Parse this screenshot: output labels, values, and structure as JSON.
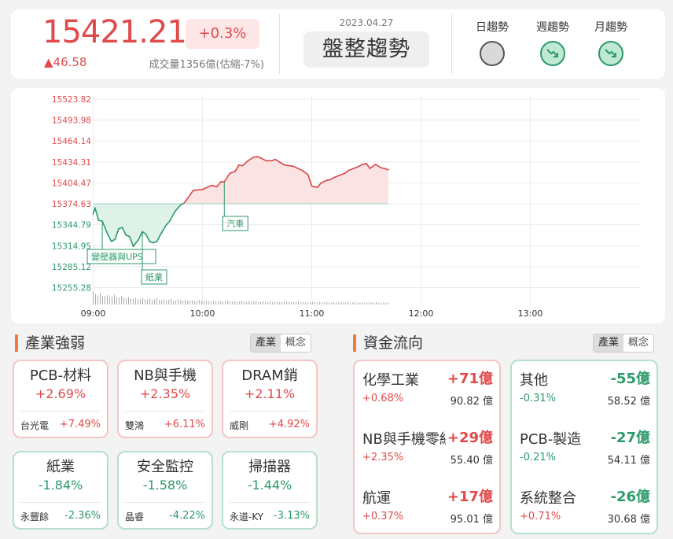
{
  "header": {
    "index_value": "15421.21",
    "index_pct": "+0.3%",
    "index_change": "▲46.58",
    "volume": "成交量1356億(估縮-7%)",
    "date": "2023.04.27",
    "trend_text": "盤整趨勢",
    "trends": [
      {
        "label": "日趨勢",
        "state": "neutral"
      },
      {
        "label": "週趨勢",
        "state": "down"
      },
      {
        "label": "月趨勢",
        "state": "down"
      }
    ]
  },
  "chart_data": {
    "type": "line",
    "y_ticks": [
      "15523.82",
      "15493.98",
      "15464.14",
      "15434.31",
      "15404.47",
      "15374.63",
      "15344.79",
      "15314.95",
      "15285.12",
      "15255.28"
    ],
    "x_ticks": [
      "09:00",
      "10:00",
      "11:00",
      "12:00",
      "13:00"
    ],
    "ylim": [
      15255.28,
      15523.82
    ],
    "reference": 15374.63,
    "series": [
      {
        "x": [
          "09:00",
          "09:01",
          "09:03",
          "09:05",
          "09:08",
          "09:10",
          "09:12",
          "09:14",
          "09:16",
          "09:18",
          "09:20",
          "09:22",
          "09:25",
          "09:27",
          "09:29",
          "09:31",
          "09:33",
          "09:35",
          "09:37",
          "09:40",
          "09:42",
          "09:45",
          "09:48",
          "09:50",
          "09:55",
          "10:00",
          "10:05",
          "10:08",
          "10:10",
          "10:12",
          "10:15",
          "10:18",
          "10:20",
          "10:22",
          "10:25",
          "10:28",
          "10:30",
          "10:32",
          "10:35",
          "10:38",
          "10:40",
          "10:45",
          "10:50",
          "10:55",
          "10:58",
          "11:00",
          "11:03",
          "11:05",
          "11:08",
          "11:10",
          "11:13",
          "11:15",
          "11:18",
          "11:20",
          "11:23",
          "11:25",
          "11:28",
          "11:30",
          "11:32",
          "11:35",
          "11:38",
          "11:40",
          "11:42"
        ],
        "values": [
          15360,
          15369,
          15351,
          15350,
          15331,
          15321,
          15324,
          15339,
          15341,
          15330,
          15328,
          15314,
          15324,
          15335,
          15331,
          15321,
          15319,
          15321,
          15331,
          15344,
          15350,
          15364,
          15373,
          15376,
          15394,
          15395,
          15401,
          15399,
          15406,
          15406,
          15418,
          15421,
          15430,
          15429,
          15436,
          15441,
          15442,
          15440,
          15436,
          15436,
          15438,
          15430,
          15428,
          15422,
          15416,
          15400,
          15398,
          15404,
          15408,
          15409,
          15413,
          15415,
          15418,
          15422,
          15425,
          15427,
          15431,
          15432,
          15425,
          15431,
          15426,
          15425,
          15423
        ]
      }
    ],
    "volume": [
      0.55,
      0.5,
      0.45,
      0.4,
      0.42,
      0.38,
      0.36,
      0.32,
      0.3,
      0.28,
      0.28,
      0.26,
      0.25,
      0.28,
      0.24,
      0.22,
      0.24,
      0.2,
      0.22,
      0.2,
      0.21,
      0.19,
      0.2,
      0.18,
      0.17,
      0.16,
      0.18,
      0.15,
      0.17,
      0.16,
      0.15,
      0.16,
      0.14,
      0.15,
      0.16,
      0.14,
      0.13,
      0.15,
      0.14,
      0.12,
      0.13,
      0.14,
      0.12,
      0.13,
      0.12,
      0.11,
      0.12,
      0.12,
      0.11,
      0.12,
      0.11,
      0.1,
      0.11,
      0.12,
      0.1,
      0.11,
      0.1,
      0.1,
      0.11,
      0.1,
      0.1,
      0.09,
      0.1
    ],
    "annotations": [
      {
        "label": "變壓器與UPS",
        "time": "09:05"
      },
      {
        "label": "紙業",
        "time": "09:27"
      },
      {
        "label": "汽車",
        "time": "10:12"
      }
    ]
  },
  "industry": {
    "title": "產業強弱",
    "tab_active": "產業",
    "tab_other": "概念",
    "cards": [
      {
        "name": "PCB-材料",
        "pct": "+2.69%",
        "stock": "台光電",
        "stock_pct": "+7.49%",
        "dir": "up"
      },
      {
        "name": "NB與手機",
        "pct": "+2.35%",
        "stock": "雙鴻",
        "stock_pct": "+6.11%",
        "dir": "up"
      },
      {
        "name": "DRAM銷",
        "pct": "+2.11%",
        "stock": "威剛",
        "stock_pct": "+4.92%",
        "dir": "up"
      },
      {
        "name": "紙業",
        "pct": "-1.84%",
        "stock": "永豐餘",
        "stock_pct": "-2.36%",
        "dir": "dn"
      },
      {
        "name": "安全監控",
        "pct": "-1.58%",
        "stock": "晶睿",
        "stock_pct": "-4.22%",
        "dir": "dn"
      },
      {
        "name": "掃描器",
        "pct": "-1.44%",
        "stock": "永道-KY",
        "stock_pct": "-3.13%",
        "dir": "dn"
      }
    ]
  },
  "flow": {
    "title": "資金流向",
    "tab_active": "產業",
    "tab_other": "概念",
    "inflow": [
      {
        "name": "化學工業",
        "amount": "+71億",
        "pct": "+0.68%",
        "value": "90.82 億"
      },
      {
        "name": "NB與手機零組件",
        "amount": "+29億",
        "pct": "+2.35%",
        "value": "55.40 億"
      },
      {
        "name": "航運",
        "amount": "+17億",
        "pct": "+0.37%",
        "value": "95.01 億"
      }
    ],
    "outflow": [
      {
        "name": "其他",
        "amount": "-55億",
        "pct": "-0.31%",
        "value": "58.52 億"
      },
      {
        "name": "PCB-製造",
        "amount": "-27億",
        "pct": "-0.21%",
        "value": "54.11 億"
      },
      {
        "name": "系統整合",
        "amount": "-26億",
        "pct": "+0.71%",
        "value": "30.68 億"
      }
    ]
  }
}
